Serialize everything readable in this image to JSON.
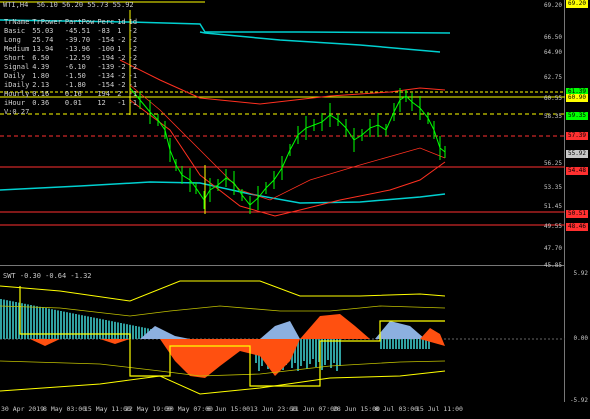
{
  "header": {
    "symbol_line": "WTI,H4  56.10 56.20 55.73 55.92"
  },
  "indicator_table": {
    "columns": [
      "TrName",
      "TrPower",
      "PartPow",
      "Perc",
      "1d",
      "1d"
    ],
    "rows": [
      [
        "Basic",
        "55.03",
        "-45.51",
        "-83",
        "1",
        "-2"
      ],
      [
        "Long",
        "25.74",
        "-39.70",
        "-154",
        "-2",
        "-2"
      ],
      [
        "Medium",
        "13.94",
        "-13.96",
        "-100",
        "1",
        "-2"
      ],
      [
        "Short",
        "6.50",
        "-12.59",
        "-194",
        "-2",
        "-2"
      ],
      [
        "Signal",
        "4.39",
        "-6.10",
        "-139",
        "-2",
        "-2"
      ],
      [
        "Daily",
        "1.80",
        "-1.50",
        "-134",
        "-2",
        "-1"
      ],
      [
        "iDaily",
        "2.13",
        "-1.80",
        "-154",
        "-2",
        "-1"
      ],
      [
        "Hourly",
        "0.16",
        "0.16",
        "194",
        "2",
        "-1"
      ],
      [
        "iHour",
        "0.36",
        "0.01",
        "12",
        "-1",
        "-1"
      ]
    ],
    "footer": "V:0.27"
  },
  "price_axis": [
    "69.20",
    "66.50",
    "64.90",
    "62.75",
    "60.55",
    "58.35",
    "56.25",
    "53.35",
    "51.45",
    "49.55",
    "47.70",
    "45.85"
  ],
  "price_tags": [
    {
      "text": "69.20",
      "color": "#ffff00"
    },
    {
      "text": "61.39",
      "color": "#00ff00"
    },
    {
      "text": "60.90",
      "color": "#ffff00"
    },
    {
      "text": "59.35",
      "color": "#00ff00"
    },
    {
      "text": "57.39",
      "color": "#ff3030"
    },
    {
      "text": "55.92",
      "color": "#c8c8c8"
    },
    {
      "text": "54.48",
      "color": "#ff3030"
    },
    {
      "text": "50.51",
      "color": "#ff3030"
    },
    {
      "text": "48.46",
      "color": "#ff3030"
    }
  ],
  "sub_header": "SWT -0.30 -0.64 -1.32",
  "sub_axis": [
    "5.92",
    "0.00",
    "-5.92"
  ],
  "time_axis": [
    "30 Apr 2019",
    "8 May 03:00",
    "15 May 11:00",
    "22 May 19:00",
    "30 May 07:00",
    "6 Jun 15:00",
    "13 Jun 23:00",
    "21 Jun 07:00",
    "28 Jun 15:00",
    "8 Jul 03:00",
    "15 Jul 11:00"
  ],
  "colors": {
    "bull": "#00ff00",
    "ma_cyan": "#00d0d0",
    "ma_red": "#ff3020",
    "level_yellow": "#ffff00",
    "level_red": "#ff3030",
    "hist_orange": "#ff5010",
    "hist_blue": "#8cb0e0",
    "hist_teal": "#30a0a0"
  }
}
